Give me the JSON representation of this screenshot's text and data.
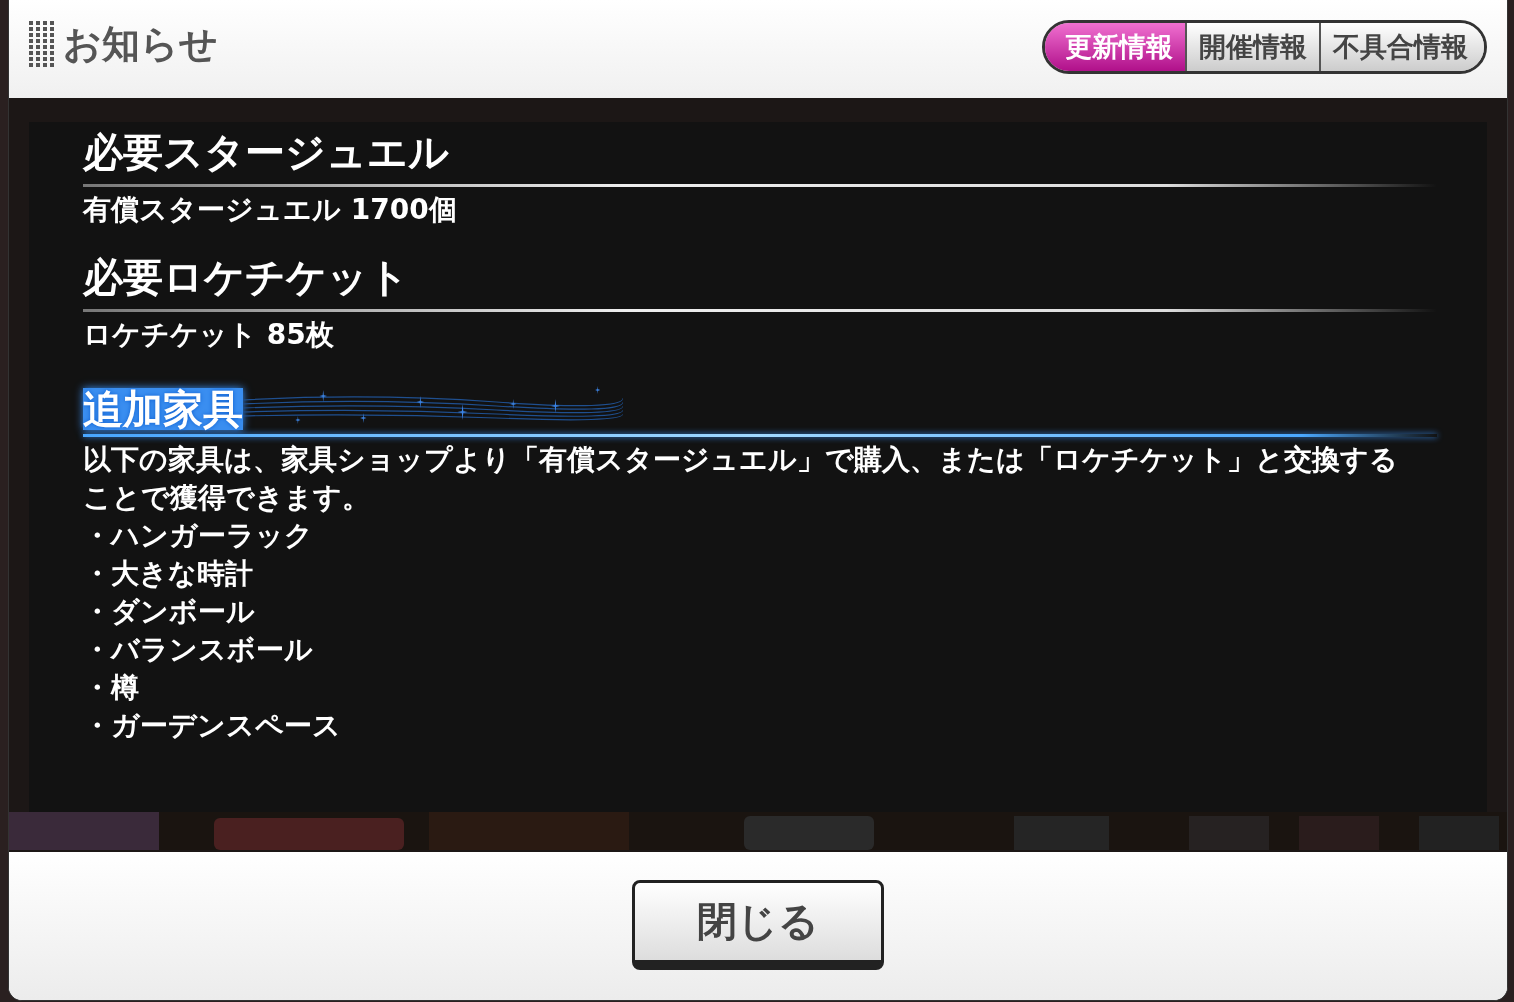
{
  "header": {
    "title": "お知らせ"
  },
  "tabs": [
    {
      "label": "更新情報",
      "selected": true
    },
    {
      "label": "開催情報",
      "selected": false
    },
    {
      "label": "不具合情報",
      "selected": false
    }
  ],
  "sections": [
    {
      "kind": "plain",
      "heading": "必要スタージュエル",
      "lines": [
        "有償スタージュエル 1700個"
      ]
    },
    {
      "kind": "plain",
      "heading": "必要ロケチケット",
      "lines": [
        "ロケチケット 85枚"
      ]
    },
    {
      "kind": "sparkle",
      "heading": "追加家具",
      "lines": [
        "以下の家具は、家具ショップより「有償スタージュエル」で購入、または「ロケチケット」と交換することで獲得できます。",
        "・ハンガーラック",
        "・大きな時計",
        "・ダンボール",
        "・バランスボール",
        "・樽",
        "・ガーデンスペース"
      ]
    }
  ],
  "close_button": "閉じる"
}
